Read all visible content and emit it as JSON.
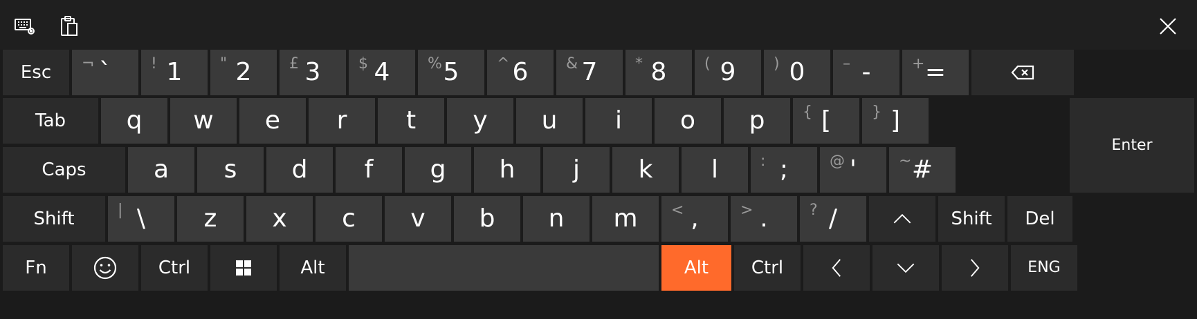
{
  "toolbar": {
    "keyboard_settings_icon": "keyboard-settings-icon",
    "clipboard_icon": "clipboard-icon",
    "close_icon": "close-icon"
  },
  "rows": {
    "numbers": [
      {
        "main": "Esc",
        "type": "label"
      },
      {
        "main": "`",
        "sec": "¬"
      },
      {
        "main": "1",
        "sec": "!"
      },
      {
        "main": "2",
        "sec": "\""
      },
      {
        "main": "3",
        "sec": "£"
      },
      {
        "main": "4",
        "sec": "$"
      },
      {
        "main": "5",
        "sec": "%"
      },
      {
        "main": "6",
        "sec": "^"
      },
      {
        "main": "7",
        "sec": "&"
      },
      {
        "main": "8",
        "sec": "*"
      },
      {
        "main": "9",
        "sec": "("
      },
      {
        "main": "0",
        "sec": ")"
      },
      {
        "main": "-",
        "sec": "–"
      },
      {
        "main": "=",
        "sec": "+"
      },
      {
        "main": "",
        "type": "backspace"
      }
    ],
    "qwerty": [
      {
        "main": "Tab",
        "type": "label"
      },
      {
        "main": "q"
      },
      {
        "main": "w"
      },
      {
        "main": "e"
      },
      {
        "main": "r"
      },
      {
        "main": "t"
      },
      {
        "main": "y"
      },
      {
        "main": "u"
      },
      {
        "main": "i"
      },
      {
        "main": "o"
      },
      {
        "main": "p"
      },
      {
        "main": "[",
        "sec": "{"
      },
      {
        "main": "]",
        "sec": "}"
      }
    ],
    "home": [
      {
        "main": "Caps",
        "type": "label"
      },
      {
        "main": "a"
      },
      {
        "main": "s"
      },
      {
        "main": "d"
      },
      {
        "main": "f"
      },
      {
        "main": "g"
      },
      {
        "main": "h"
      },
      {
        "main": "j"
      },
      {
        "main": "k"
      },
      {
        "main": "l"
      },
      {
        "main": ";",
        "sec": ":"
      },
      {
        "main": "'",
        "sec": "@"
      },
      {
        "main": "#",
        "sec": "~"
      }
    ],
    "enter": {
      "main": "Enter"
    },
    "bottom": [
      {
        "main": "Shift",
        "type": "label"
      },
      {
        "main": "\\",
        "sec": "|"
      },
      {
        "main": "z"
      },
      {
        "main": "x"
      },
      {
        "main": "c"
      },
      {
        "main": "v"
      },
      {
        "main": "b"
      },
      {
        "main": "n"
      },
      {
        "main": "m"
      },
      {
        "main": ",",
        "sec": "<"
      },
      {
        "main": ".",
        "sec": ">"
      },
      {
        "main": "/",
        "sec": "?"
      },
      {
        "main": "",
        "type": "up-arrow"
      },
      {
        "main": "Shift",
        "type": "label"
      },
      {
        "main": "Del",
        "type": "label"
      }
    ],
    "control": [
      {
        "main": "Fn",
        "type": "label"
      },
      {
        "main": "",
        "type": "emoji"
      },
      {
        "main": "Ctrl",
        "type": "label"
      },
      {
        "main": "",
        "type": "windows"
      },
      {
        "main": "Alt",
        "type": "label"
      },
      {
        "main": "",
        "type": "space"
      },
      {
        "main": "Alt",
        "type": "label",
        "active": true
      },
      {
        "main": "Ctrl",
        "type": "label"
      },
      {
        "main": "",
        "type": "left-arrow"
      },
      {
        "main": "",
        "type": "down-arrow"
      },
      {
        "main": "",
        "type": "right-arrow"
      },
      {
        "main": "ENG",
        "type": "label-small"
      }
    ]
  },
  "colors": {
    "background": "#1b1b1b",
    "key": "#3a3a3a",
    "key_dark": "#2b2b2b",
    "accent": "#ff6a2b"
  }
}
